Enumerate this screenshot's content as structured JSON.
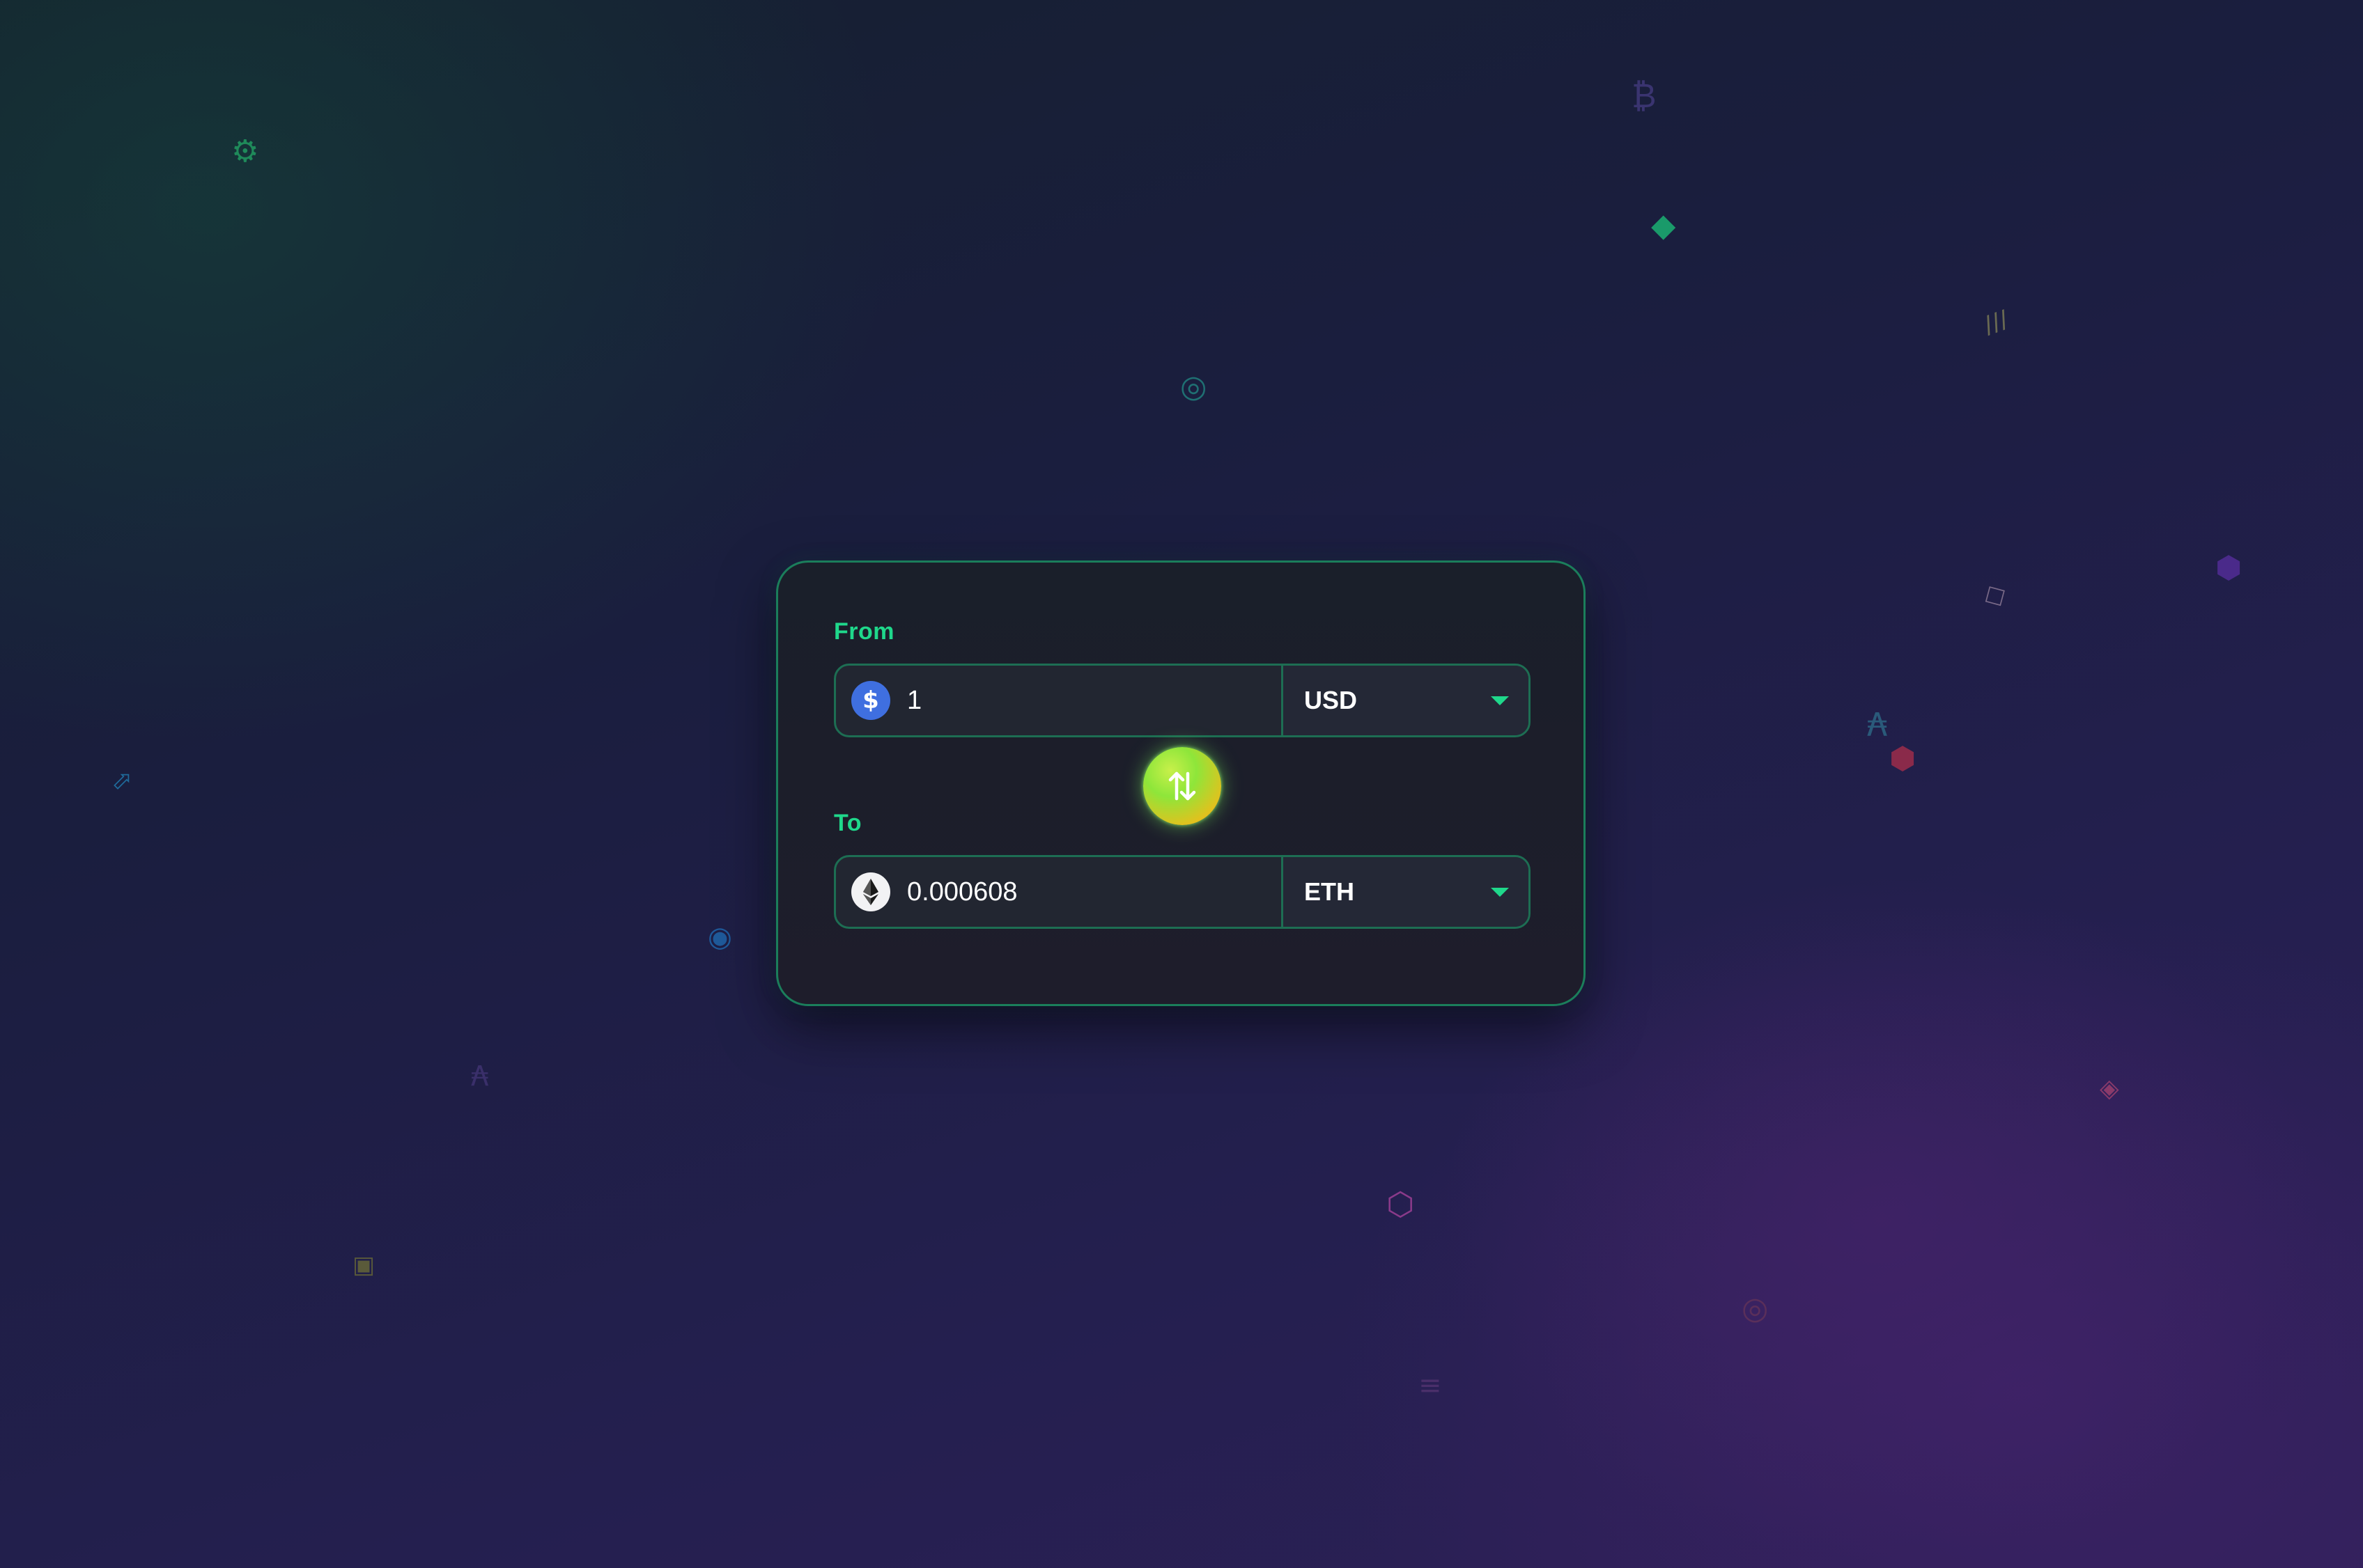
{
  "converter": {
    "from": {
      "label": "From",
      "amount": "1",
      "currency": "USD",
      "coin_icon": "dollar-coin-icon",
      "coin_color": "#3f6fe0"
    },
    "to": {
      "label": "To",
      "amount": "0.000608",
      "currency": "ETH",
      "coin_icon": "ethereum-coin-icon",
      "coin_color": "#f2f2f4"
    },
    "swap_icon": "swap-arrows-icon"
  },
  "theme": {
    "accent": "#1fd88b",
    "border": "#1b7e5b",
    "card_background": "#1c1e2a",
    "swap_gradient": [
      "#8ee63a",
      "#f0a020"
    ]
  },
  "background_decorations": [
    {
      "icon": "cog-icon",
      "color": "#1f8a5a"
    },
    {
      "icon": "bitcoin-icon",
      "color": "#3a3470"
    },
    {
      "icon": "gem-icon",
      "color": "#1a9a6a"
    },
    {
      "icon": "target-icon",
      "color": "#1f6f72"
    },
    {
      "icon": "bars-icon",
      "color": "#6a6a52"
    },
    {
      "icon": "hexagon-icon",
      "color": "#4a2a8a"
    },
    {
      "icon": "square-icon",
      "color": "#7a6a88"
    },
    {
      "icon": "cardano-icon",
      "color": "#2a5a7a"
    },
    {
      "icon": "red-hexagon-icon",
      "color": "#8a2a4a"
    },
    {
      "icon": "chart-icon",
      "color": "#1f6a9a"
    },
    {
      "icon": "blue-dot-icon",
      "color": "#1f5a9a"
    },
    {
      "icon": "triangle-icon",
      "color": "#3a2f6a"
    },
    {
      "icon": "box-icon",
      "color": "#5a5a3a"
    },
    {
      "icon": "hexagon-outline-icon",
      "color": "#8a3a8a"
    },
    {
      "icon": "diamond-icon",
      "color": "#8a3a6a"
    },
    {
      "icon": "ring-icon",
      "color": "#5a2f5a"
    },
    {
      "icon": "lines-icon",
      "color": "#4a2f6a"
    }
  ]
}
